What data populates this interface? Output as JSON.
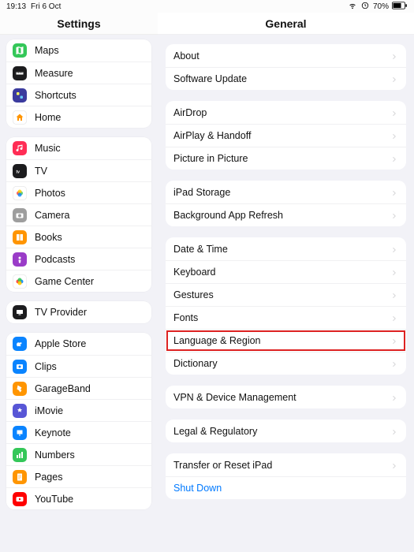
{
  "status": {
    "time": "19:13",
    "date": "Fri 6 Oct",
    "battery": "70%"
  },
  "leftTitle": "Settings",
  "rightTitle": "General",
  "sidebar": {
    "groups": [
      [
        {
          "label": "Maps",
          "bg": "#34c759",
          "icon": "map"
        },
        {
          "label": "Measure",
          "bg": "#1c1c1e",
          "icon": "ruler"
        },
        {
          "label": "Shortcuts",
          "bg": "#3b3b9e",
          "icon": "shortcut"
        },
        {
          "label": "Home",
          "bg": "#ffffff",
          "icon": "home"
        }
      ],
      [
        {
          "label": "Music",
          "bg": "#ff2d55",
          "icon": "music"
        },
        {
          "label": "TV",
          "bg": "#1c1c1e",
          "icon": "tv"
        },
        {
          "label": "Photos",
          "bg": "#ffffff",
          "icon": "photos"
        },
        {
          "label": "Camera",
          "bg": "#9e9e9e",
          "icon": "camera"
        },
        {
          "label": "Books",
          "bg": "#ff9500",
          "icon": "books"
        },
        {
          "label": "Podcasts",
          "bg": "#9a3cc8",
          "icon": "podcast"
        },
        {
          "label": "Game Center",
          "bg": "#ffffff",
          "icon": "gamecenter"
        }
      ],
      [
        {
          "label": "TV Provider",
          "bg": "#1c1c1e",
          "icon": "tvprovider"
        }
      ],
      [
        {
          "label": "Apple Store",
          "bg": "#0a84ff",
          "icon": "applestore"
        },
        {
          "label": "Clips",
          "bg": "#0a84ff",
          "icon": "clips"
        },
        {
          "label": "GarageBand",
          "bg": "#ff9500",
          "icon": "garageband"
        },
        {
          "label": "iMovie",
          "bg": "#5856d6",
          "icon": "imovie"
        },
        {
          "label": "Keynote",
          "bg": "#0a84ff",
          "icon": "keynote"
        },
        {
          "label": "Numbers",
          "bg": "#34c759",
          "icon": "numbers"
        },
        {
          "label": "Pages",
          "bg": "#ff9500",
          "icon": "pages"
        },
        {
          "label": "YouTube",
          "bg": "#ff0000",
          "icon": "youtube"
        }
      ]
    ]
  },
  "general": {
    "sections": [
      [
        {
          "label": "About"
        },
        {
          "label": "Software Update"
        }
      ],
      [
        {
          "label": "AirDrop"
        },
        {
          "label": "AirPlay & Handoff"
        },
        {
          "label": "Picture in Picture"
        }
      ],
      [
        {
          "label": "iPad Storage"
        },
        {
          "label": "Background App Refresh"
        }
      ],
      [
        {
          "label": "Date & Time"
        },
        {
          "label": "Keyboard"
        },
        {
          "label": "Gestures"
        },
        {
          "label": "Fonts"
        },
        {
          "label": "Language & Region",
          "highlight": true
        },
        {
          "label": "Dictionary"
        }
      ],
      [
        {
          "label": "VPN & Device Management"
        }
      ],
      [
        {
          "label": "Legal & Regulatory"
        }
      ],
      [
        {
          "label": "Transfer or Reset iPad"
        },
        {
          "label": "Shut Down",
          "link": true,
          "noChevron": true
        }
      ]
    ]
  }
}
